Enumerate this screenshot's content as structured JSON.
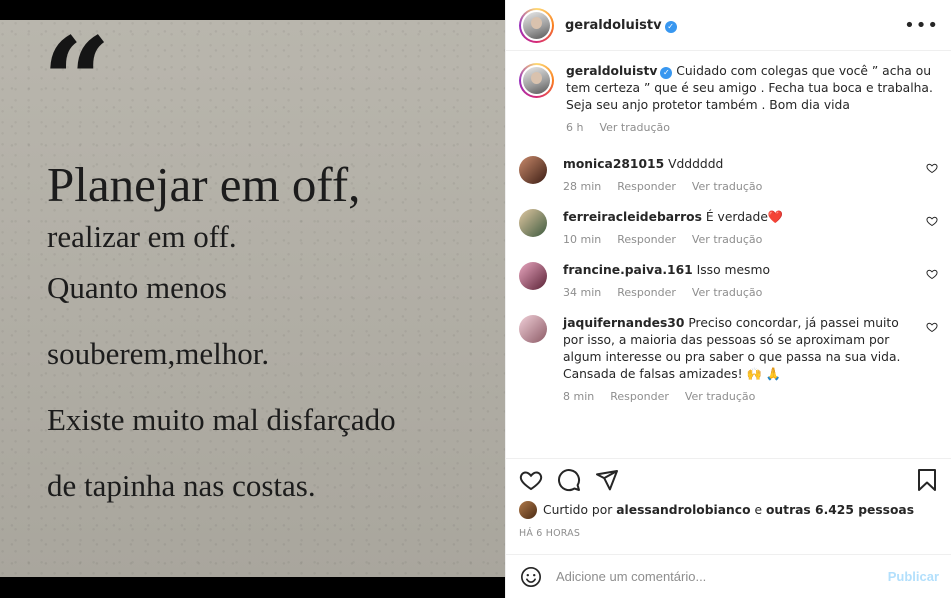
{
  "post": {
    "username": "geraldoluistv",
    "verified_mark": "✓",
    "more_glyph": "•••"
  },
  "image": {
    "quote_mark": "“",
    "line1": "Planejar em off,",
    "line2": "realizar em off.",
    "line3": "Quanto menos",
    "line4": "souberem,melhor.",
    "line5": "Existe muito mal disfarçado",
    "line6": "de tapinha nas costas."
  },
  "caption": {
    "username": "geraldoluistv",
    "text": "Cuidado com colegas que você ” acha ou tem certeza ” que é seu amigo . Fecha tua boca e trabalha. Seja seu anjo protetor também . Bom dia vida",
    "time": "6 h",
    "translate": "Ver tradução"
  },
  "comments": [
    {
      "username": "monica281015",
      "text": "Vdddddd",
      "time": "28 min",
      "reply": "Responder",
      "translate": "Ver tradução",
      "avatar_color": "#7a4b3c"
    },
    {
      "username": "ferreiracleidebarros",
      "text": "É verdade❤️",
      "time": "10 min",
      "reply": "Responder",
      "translate": "Ver tradução",
      "avatar_color": "#3c6a55"
    },
    {
      "username": "francine.paiva.161",
      "text": "Isso mesmo",
      "time": "34 min",
      "reply": "Responder",
      "translate": "Ver tradução",
      "avatar_color": "#b8527a"
    },
    {
      "username": "jaquifernandes30",
      "text": "Preciso concordar, já passei muito por isso, a maioria das pessoas só se aproximam por algum interesse ou pra saber o que passa na sua vida. Cansada de falsas amizades! 🙌 🙏",
      "time": "8 min",
      "reply": "Responder",
      "translate": "Ver tradução",
      "avatar_color": "#d1a3b0"
    }
  ],
  "likes": {
    "prefix": "Curtido por",
    "user": "alessandrolobianco",
    "middle": "e",
    "others": "outras 6.425 pessoas"
  },
  "posted_ago": "HÁ 6 HORAS",
  "add_comment": {
    "placeholder": "Adicione um comentário...",
    "publish": "Publicar"
  },
  "colors": {
    "verified": "#3897f0",
    "heart": "#ed4956",
    "publish_disabled": "#b2dffc",
    "muted": "#8e8e8e"
  }
}
